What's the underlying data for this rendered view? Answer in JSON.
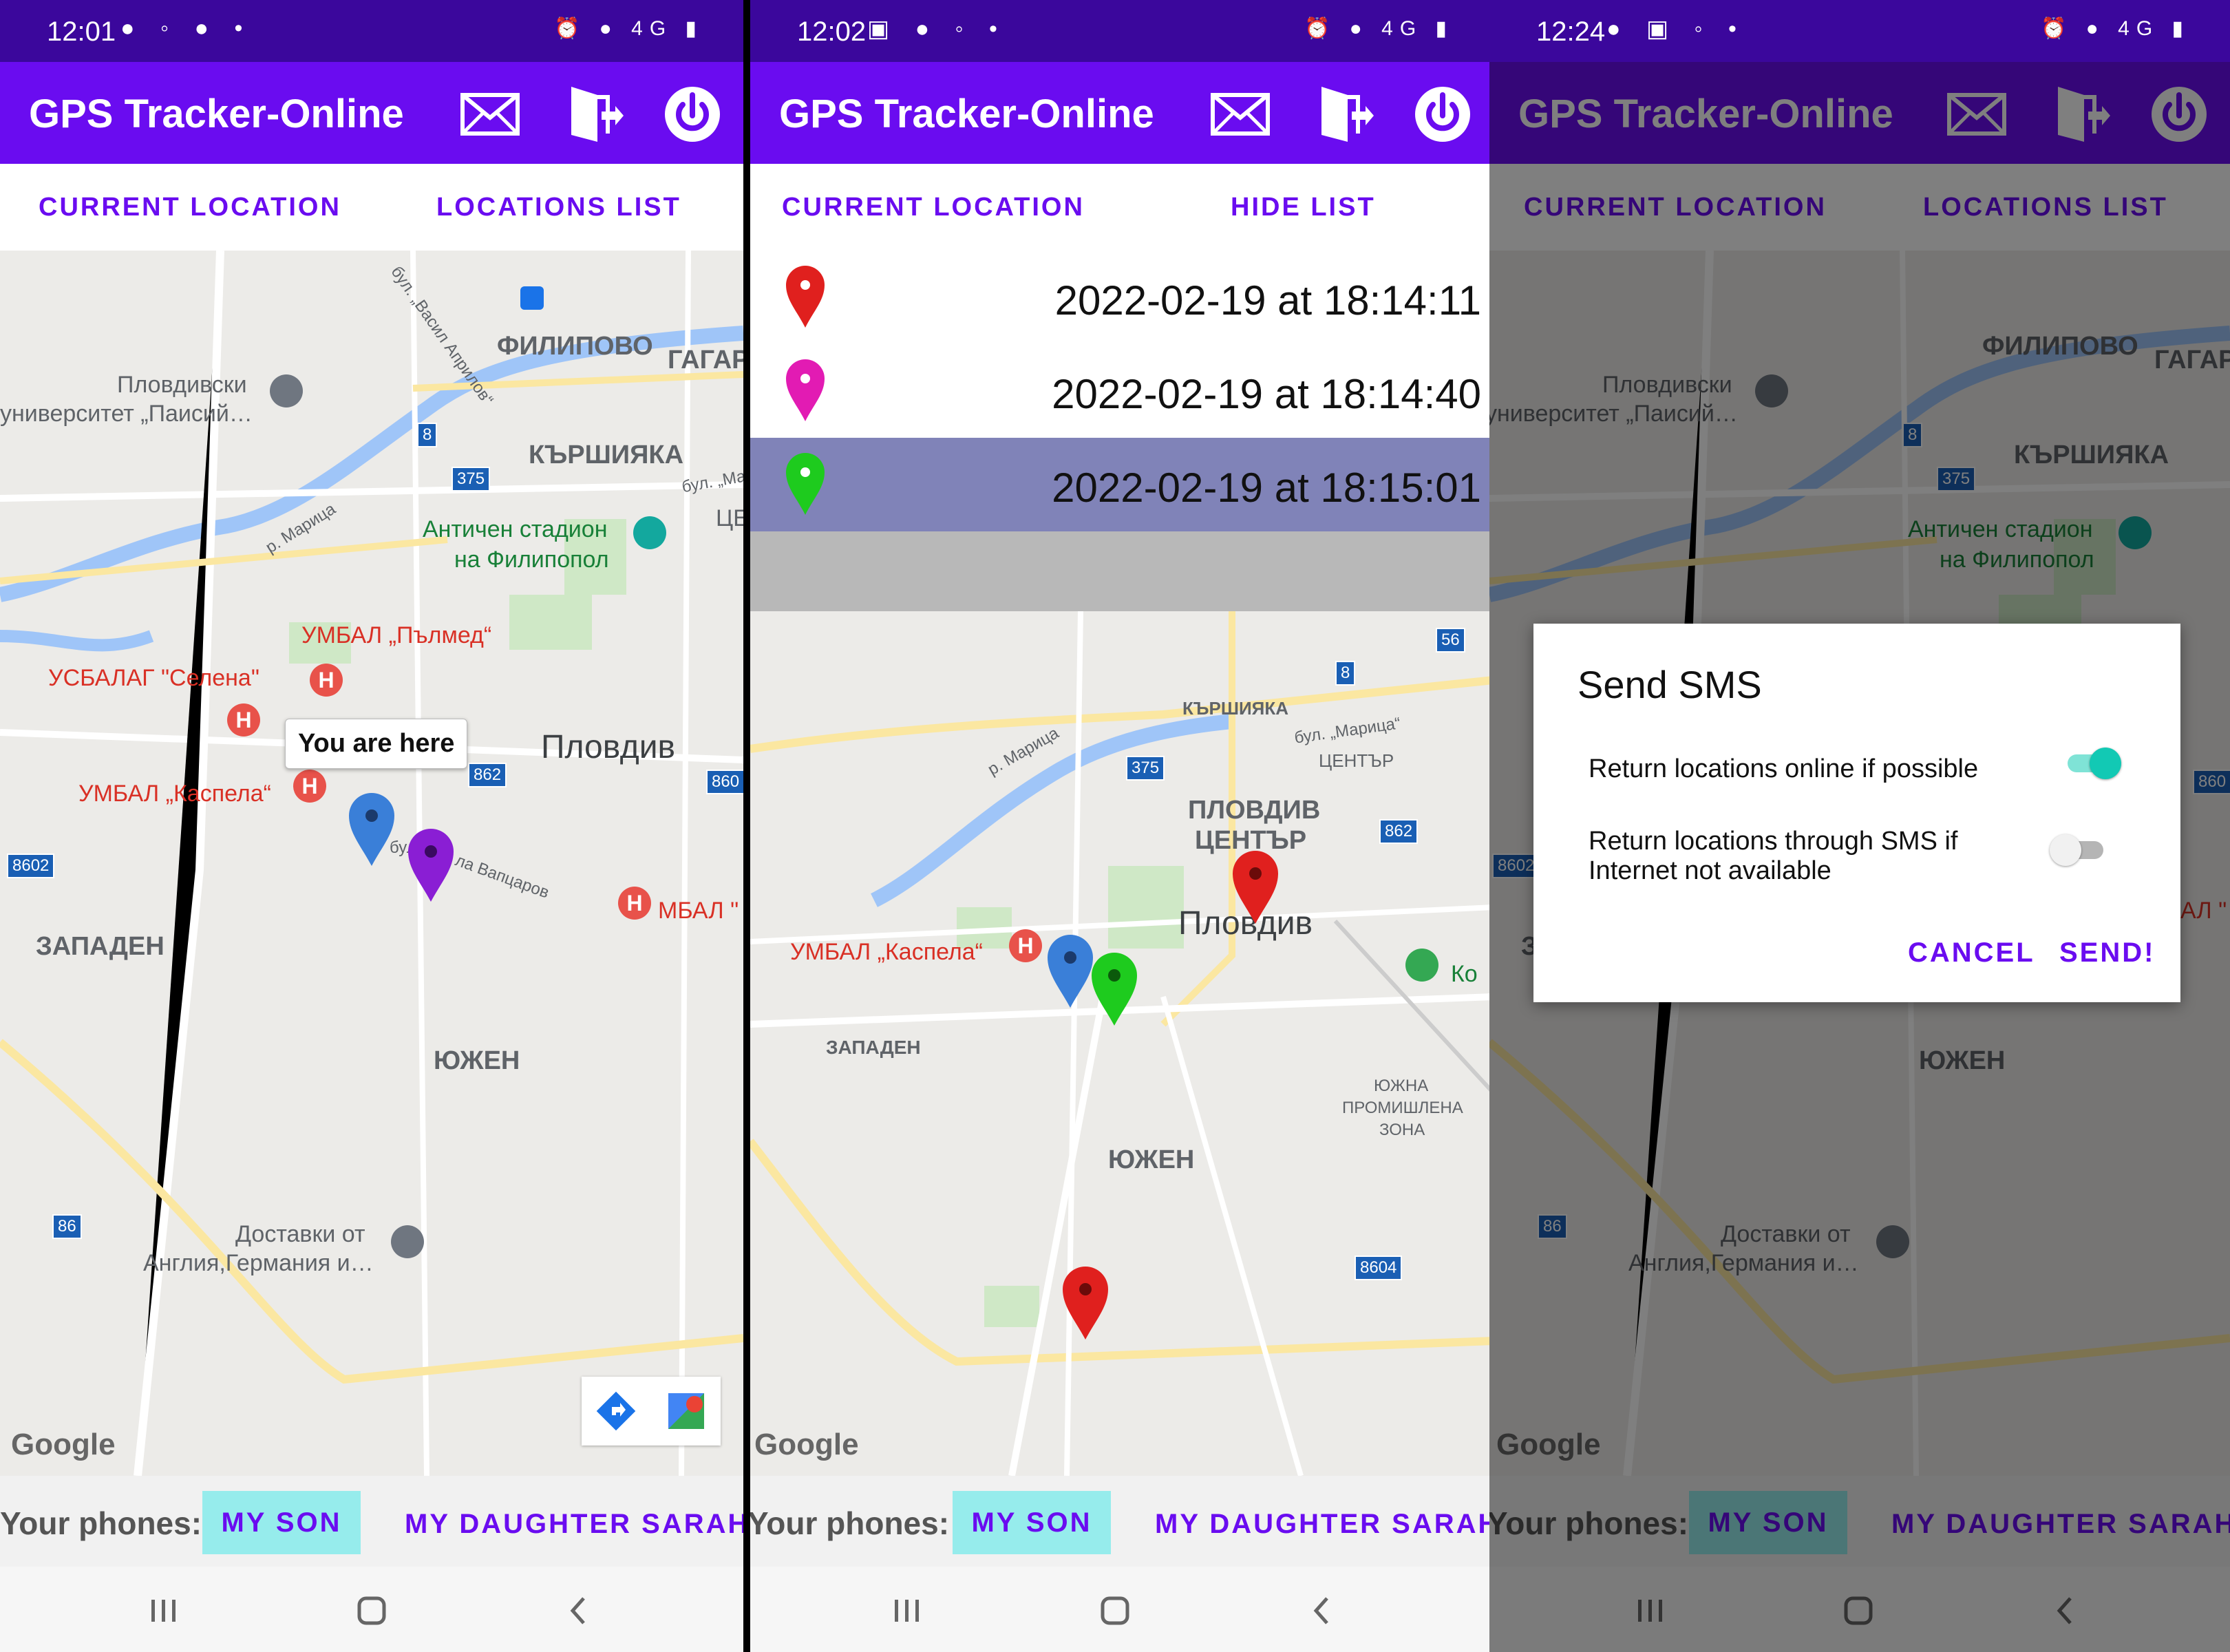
{
  "app": {
    "title": "GPS Tracker-Online",
    "accent": "#6a0cf0",
    "statusbar_color": "#3b079c",
    "actions": [
      "envelope-icon",
      "exit-door-icon",
      "power-icon"
    ]
  },
  "screens": [
    {
      "status_time": "12:01",
      "tabs": {
        "left": "CURRENT LOCATION",
        "right": "LOCATIONS LIST"
      },
      "map": {
        "tooltip": "You are here",
        "labels": {
          "filipovo": "ФИЛИПОВО",
          "gagarin": "ГАГАРИ",
          "plovdiv_uni": "Пловдивски",
          "plovdiv_uni2": "университет „Паисий…",
          "karshiyaka": "КЪРШИЯКА",
          "stadium": "Античен стадион",
          "stadium2": "на Филипопол",
          "pulmed": "УМБАЛ „Пълмед“",
          "selena": "УСБАЛАГ \"Селена\"",
          "kaspela": "УМБАЛ „Каспела“",
          "plovdiv": "Пловдив",
          "zapaden": "ЗАПАДЕН",
          "yuzhen": "ЮЖЕН",
          "mbal": "МБАЛ \"",
          "delivery": "Доставки от",
          "delivery2": "Англия,Германия и…",
          "maritsa": "р. Марица",
          "vaptsarov": "ла Вапцаров",
          "vasil_aprilov": "бул. „Васил Априлов“",
          "bul_maritsa": "бул. „Мари",
          "tse": "ЦЕ",
          "bu": "бул"
        },
        "shields": {
          "s8": "8",
          "s375": "375",
          "s862": "862",
          "s860": "860",
          "s8602": "8602",
          "s86": "86"
        },
        "google": "Google"
      },
      "phones": {
        "label": "Your phones:",
        "son": "MY SON",
        "daughter": "MY DAUGHTER SARAH"
      }
    },
    {
      "status_time": "12:02",
      "tabs": {
        "left": "CURRENT LOCATION",
        "right": "HIDE LIST"
      },
      "locations": [
        {
          "time": "2022-02-19 at 18:14:11",
          "pin_color": "#e0201e"
        },
        {
          "time": "2022-02-19 at 18:14:40",
          "pin_color": "#e21bb3"
        },
        {
          "time": "2022-02-19 at 18:15:01",
          "pin_color": "#1ecb1e",
          "selected": true
        }
      ],
      "map": {
        "labels": {
          "karshiyaka": "КЪРШИЯКА",
          "bul_maritsa": "бул. „Марица“",
          "center": "ЦЕНТЪР",
          "plovdiv_center": "ПЛОВДИВ",
          "plovdiv_center2": "ЦЕНТЪР",
          "plovdiv": "Пловдив",
          "kaspela": "УМБАЛ „Каспела“",
          "zapaden": "ЗАПАДЕН",
          "yuzhen": "ЮЖЕН",
          "zone1": "ЮЖНА",
          "zone2": "ПРОМИШЛЕНА",
          "zone3": "ЗОНА",
          "ko": "Ко",
          "maritsa": "р. Марица"
        },
        "shields": {
          "s56": "56",
          "s8": "8",
          "s375": "375",
          "s862": "862",
          "s8604": "8604"
        },
        "google": "Google"
      },
      "phones": {
        "label": "Your phones:",
        "son": "MY SON",
        "daughter": "MY DAUGHTER SARAH"
      }
    },
    {
      "status_time": "12:24",
      "tabs": {
        "left": "CURRENT LOCATION",
        "right": "LOCATIONS LIST"
      },
      "map": {
        "labels": {
          "filipovo": "ФИЛИПОВО",
          "gagarin": "ГАГАРИ",
          "plovdiv_uni": "Пловдивски",
          "plovdiv_uni2": "университет „Паисий…",
          "karshiyaka": "КЪРШИЯКА",
          "stadium": "Античен стадион",
          "stadium2": "на Филипопол",
          "yuzhen": "ЮЖЕН",
          "delivery": "Доставки от",
          "delivery2": "Англия,Германия и…",
          "al": "АЛ \"",
          "z": "З"
        },
        "shields": {
          "s8": "8",
          "s375": "375",
          "s8602": "8602",
          "s86": "86",
          "s860": "860"
        },
        "google": "Google"
      },
      "dialog": {
        "title": "Send SMS",
        "option1": "Return locations online if possible",
        "option1_on": true,
        "option2": "Return locations through SMS if Internet not available",
        "option2_on": false,
        "cancel": "CANCEL",
        "send": "SEND!"
      },
      "phones": {
        "label": "Your phones:",
        "son": "MY SON",
        "daughter": "MY DAUGHTER SARAH"
      }
    }
  ]
}
